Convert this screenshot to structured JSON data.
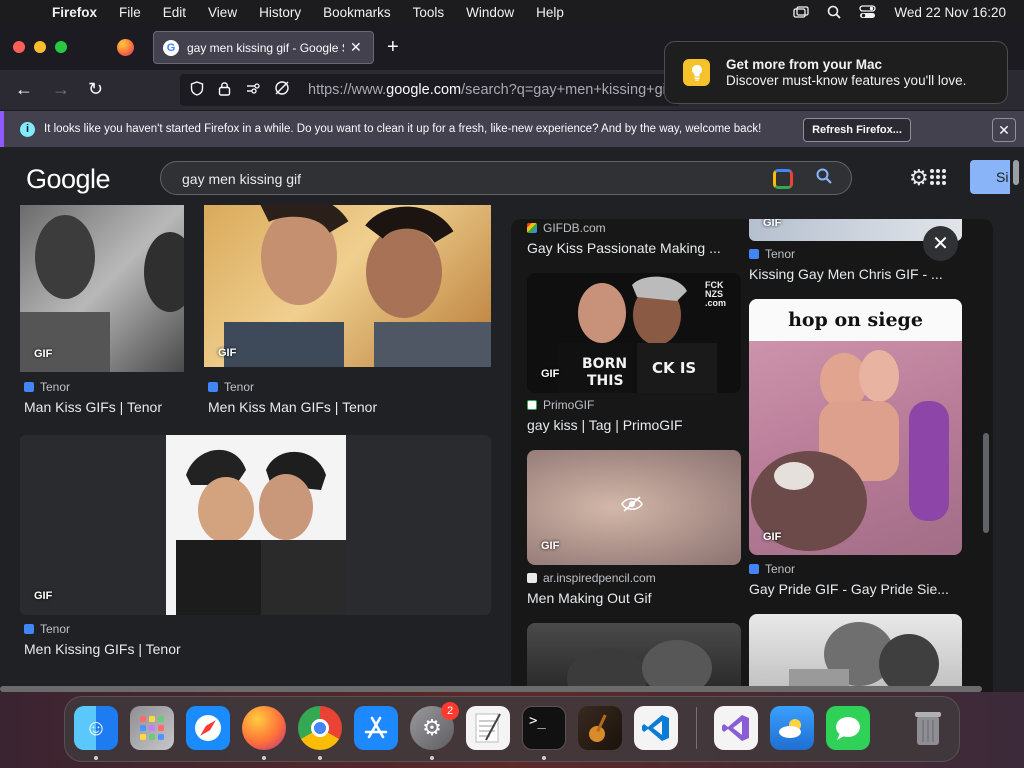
{
  "menubar": {
    "app_name": "Firefox",
    "items": [
      "File",
      "Edit",
      "View",
      "History",
      "Bookmarks",
      "Tools",
      "Window",
      "Help"
    ],
    "clock": "Wed 22 Nov  16:20"
  },
  "tabs": {
    "active_title": "gay men kissing gif - Google Se"
  },
  "urlbar": {
    "prefix": "https://www.",
    "host": "google.com",
    "path": "/search?q=gay+men+kissing+gif&"
  },
  "notification": {
    "title": "Get more from your Mac",
    "body": "Discover must-know features you'll love."
  },
  "infobar": {
    "message": "It looks like you haven't started Firefox in a while. Do you want to clean it up for a fresh, like-new experience? And by the way, welcome back!",
    "button": "Refresh Firefox..."
  },
  "google": {
    "logo": "Google",
    "query": "gay men kissing gif",
    "signin_partial": "Si"
  },
  "results": {
    "gif_label": "GIF",
    "left": [
      {
        "source": "Tenor",
        "caption": "Man Kiss GIFs | Tenor"
      },
      {
        "source": "Tenor",
        "caption": "Men Kiss Man GIFs | Tenor"
      },
      {
        "source": "Tenor",
        "caption": "Men Kissing GIFs | Tenor"
      }
    ],
    "panel": [
      {
        "source": "GIFDB.com",
        "caption": "Gay Kiss Passionate Making ..."
      },
      {
        "source": "Tenor",
        "caption": "Kissing Gay Men Chris GIF - ..."
      },
      {
        "source": "PrimoGIF",
        "caption": "gay kiss | Tag | PrimoGIF"
      },
      {
        "source": "ar.inspiredpencil.com",
        "caption": "Men Making Out Gif"
      },
      {
        "source": "Tenor",
        "caption": "Gay Pride GIF - Gay Pride Sie..."
      }
    ],
    "hop_text": "hop on siege",
    "shirt_text": "FCK NZS .com"
  },
  "dock": {
    "settings_badge": "2"
  }
}
